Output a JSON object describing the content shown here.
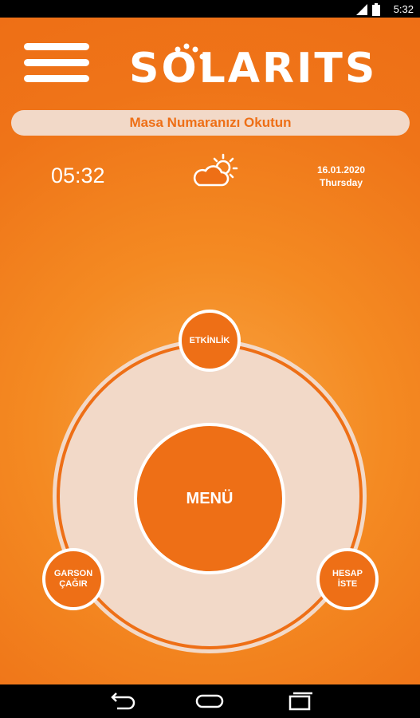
{
  "status_bar": {
    "time": "5:32"
  },
  "header": {
    "logo_text": "SOLARITS"
  },
  "scan_bar": {
    "label": "Masa Numaranızı Okutun"
  },
  "info": {
    "clock": "05:32",
    "date": "16.01.2020",
    "weekday": "Thursday",
    "weather_icon": "partly-cloudy-icon"
  },
  "wheel": {
    "center_label": "MENÜ",
    "top_label": "ETKİNLİK",
    "left_label_line1": "GARSON",
    "left_label_line2": "ÇAĞIR",
    "right_label_line1": "HESAP",
    "right_label_line2": "İSTE"
  },
  "colors": {
    "primary": "#ee6f16",
    "light": "#f2d9c8",
    "white": "#ffffff"
  }
}
